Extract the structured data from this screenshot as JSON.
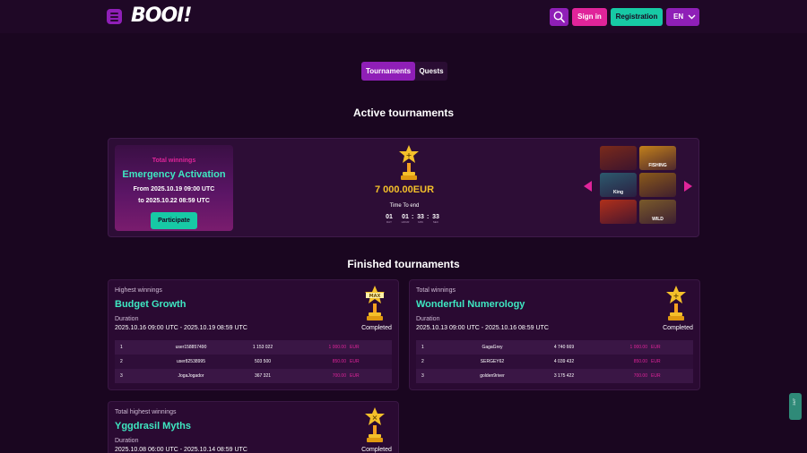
{
  "header": {
    "logo": "BOOI!",
    "signin_label": "Sign in",
    "register_label": "Registration",
    "language": "EN",
    "icons": {
      "menu": "menu-icon",
      "search": "search-icon",
      "chevron": "chevron-down-icon"
    },
    "colors": {
      "accent_purple": "#8f1fb7",
      "signin_pink": "#e0249a",
      "register_teal": "#17c9a5"
    }
  },
  "tabs": [
    {
      "label": "Tournaments",
      "active": true
    },
    {
      "label": "Quests",
      "active": false
    }
  ],
  "active_section": {
    "title": "Active tournaments",
    "tournament": {
      "winnings_label": "Total winnings",
      "name": "Emergency Activation",
      "date_from": "From 2025.10.19 09:00 UTC",
      "date_to": "to 2025.10.22 08:59 UTC",
      "participate_label": "Participate",
      "prize": "7 000.00EUR",
      "time_to_end_label": "Time To end",
      "timer": {
        "days": "01",
        "hours": "01",
        "minutes": "33",
        "seconds": "33",
        "days_label": "DAY",
        "hours_label": "HOUR",
        "minutes_label": "MIN",
        "seconds_label": "SEC"
      },
      "games": [
        {
          "title": "",
          "color": "#7a2a1a"
        },
        {
          "title": "FISHING",
          "color": "#c2801a"
        },
        {
          "title": "King",
          "color": "#2c5a6e"
        },
        {
          "title": "",
          "color": "#8a5a1a"
        },
        {
          "title": "",
          "color": "#b0301a"
        },
        {
          "title": "WILD",
          "color": "#7a5a2a"
        }
      ]
    }
  },
  "finished_section": {
    "title": "Finished tournaments",
    "cards": [
      {
        "type_label": "Highest winnings",
        "name": "Budget Growth",
        "duration_label": "Duration",
        "dates": "2025.10.16 09:00 UTC - 2025.10.19 08:59 UTC",
        "status": "Completed",
        "trophy": "max-trophy-icon",
        "rows": [
          {
            "rank": "1",
            "user": "user158857490",
            "score": "1 153 022",
            "prize": "1 000.00",
            "currency": "EUR"
          },
          {
            "rank": "2",
            "user": "user82538995",
            "score": "503 500",
            "prize": "850.00",
            "currency": "EUR"
          },
          {
            "rank": "3",
            "user": "JogaJogador",
            "score": "367 321",
            "prize": "700.00",
            "currency": "EUR"
          }
        ]
      },
      {
        "type_label": "Total winnings",
        "name": "Wonderful Numerology",
        "duration_label": "Duration",
        "dates": "2025.10.13 09:00 UTC - 2025.10.16 08:59 UTC",
        "status": "Completed",
        "trophy": "plus-trophy-icon",
        "rows": [
          {
            "rank": "1",
            "user": "GagaGrey",
            "score": "4 740 669",
            "prize": "1 000.00",
            "currency": "EUR"
          },
          {
            "rank": "2",
            "user": "SERGEY62",
            "score": "4 039 432",
            "prize": "850.00",
            "currency": "EUR"
          },
          {
            "rank": "3",
            "user": "golden9river",
            "score": "3 175 422",
            "prize": "700.00",
            "currency": "EUR"
          }
        ]
      },
      {
        "type_label": "Total highest winnings",
        "name": "Yggdrasil Myths",
        "duration_label": "Duration",
        "dates": "2025.10.08 06:00 UTC - 2025.10.14 08:59 UTC",
        "status": "Completed",
        "trophy": "multiply-trophy-icon",
        "rows": []
      }
    ]
  },
  "support_tab": "24/7"
}
